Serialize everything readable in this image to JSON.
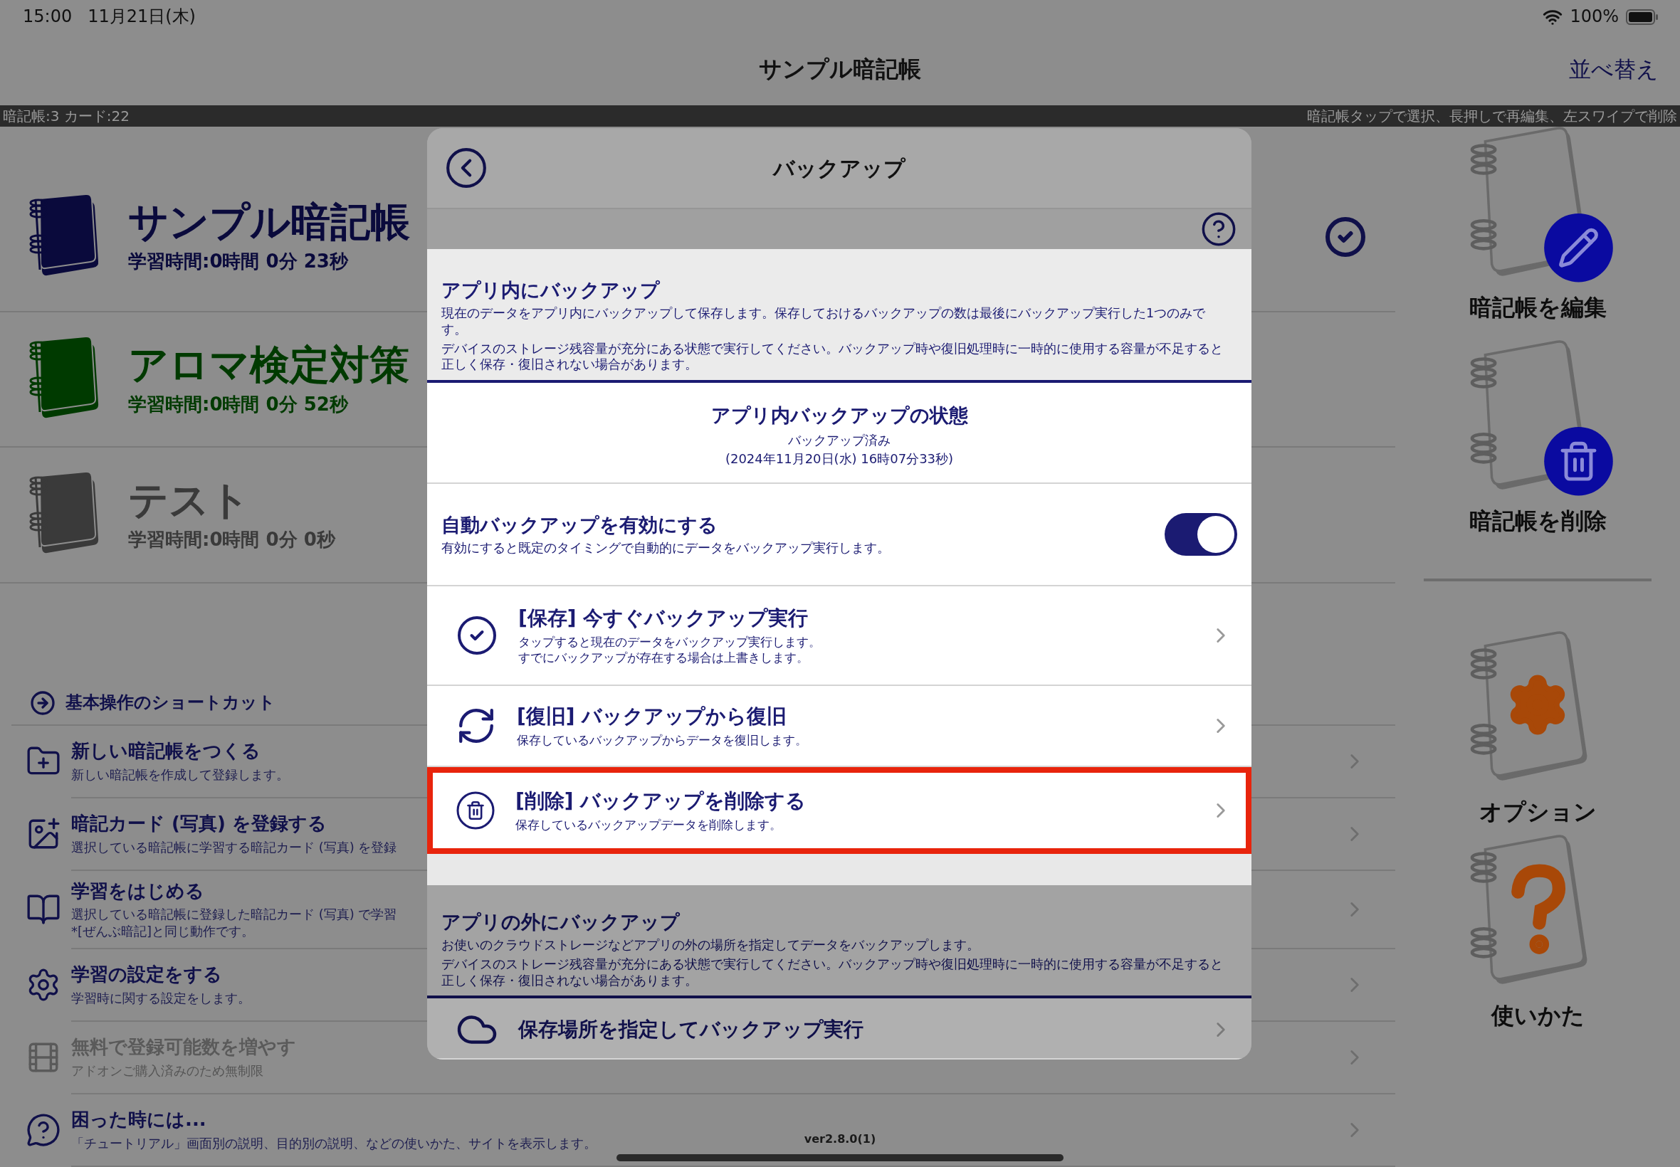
{
  "status_bar": {
    "time": "15:00",
    "date": "11月21日(木)",
    "battery": "100%"
  },
  "nav": {
    "title": "サンプル暗記帳",
    "right_button": "並べ替え"
  },
  "info_strip": {
    "counts": "暗記帳:3 カード:22",
    "hint": "暗記帳タップで選択、長押しで再編集、左スワイプで削除"
  },
  "notebooks": [
    {
      "name": "サンプル暗記帳",
      "time": "学習時間:0時間 0分 23秒",
      "color": "#0a0a3c",
      "selected": true
    },
    {
      "name": "アロマ検定対策",
      "time": "学習時間:0時間 0分 52秒",
      "color": "#003a00",
      "selected": false
    },
    {
      "name": "テスト",
      "time": "学習時間:0時間 0分 0秒",
      "color": "#3a3a3a",
      "selected": false
    }
  ],
  "shortcuts": {
    "title": "基本操作のショートカット",
    "items": [
      {
        "kind": "folder",
        "title": "新しい暗記帳をつくる",
        "description": "新しい暗記帳を作成して登録します。",
        "disabled": false
      },
      {
        "kind": "image",
        "title": "暗記カード (写真) を登録する",
        "description": "選択している暗記帳に学習する暗記カード (写真) を登録",
        "disabled": false
      },
      {
        "kind": "book",
        "title": "学習をはじめる",
        "description": "選択している暗記帳に登録した暗記カード (写真) で学習",
        "note": "*[ぜんぶ暗記]と同じ動作です。",
        "disabled": false
      },
      {
        "kind": "gear",
        "title": "学習の設定をする",
        "description": "学習時に関する設定をします。",
        "disabled": false
      },
      {
        "kind": "film",
        "title": "無料で登録可能数を増やす",
        "description": "アドオンご購入済みのため無制限",
        "disabled": true
      },
      {
        "kind": "help",
        "title": "困った時には...",
        "description": "「チュートリアル」画面別の説明、目的別の説明、などの使いかた、サイトを表示します。",
        "disabled": false
      }
    ]
  },
  "side_actions": [
    {
      "kind": "edit",
      "label": "暗記帳を編集"
    },
    {
      "kind": "delete",
      "label": "暗記帳を削除"
    },
    {
      "kind": "options",
      "label": "オプション"
    },
    {
      "kind": "help",
      "label": "使いかた"
    }
  ],
  "version": "ver2.8.0(1)",
  "modal": {
    "title": "バックアップ",
    "in_app": {
      "title": "アプリ内にバックアップ",
      "paragraphs": [
        "現在のデータをアプリ内にバックアップして保存します。保存しておけるバックアップの数は最後にバックアップ実行した1つのみです。",
        "デバイスのストレージ残容量が充分にある状態で実行してください。バックアップ時や復旧処理時に一時的に使用する容量が不足すると正しく保存・復旧されない場合があります。"
      ]
    },
    "status": {
      "title": "アプリ内バックアップの状態",
      "state": "バックアップ済み",
      "timestamp": "(2024年11月20日(水) 16時07分33秒)"
    },
    "auto_backup": {
      "title": "自動バックアップを有効にする",
      "description": "有効にすると既定のタイミングで自動的にデータをバックアップ実行します。",
      "on": true
    },
    "actions": [
      {
        "kind": "save",
        "title": "[保存] 今すぐバックアップ実行",
        "description": "タップすると現在のデータをバックアップ実行します。",
        "note": "すでにバックアップが存在する場合は上書きします。",
        "highlighted": false
      },
      {
        "kind": "restore",
        "title": "[復旧] バックアップから復旧",
        "description": "保存しているバックアップからデータを復旧します。",
        "highlighted": false
      },
      {
        "kind": "delete",
        "title": "[削除] バックアップを削除する",
        "description": "保存しているバックアップデータを削除します。",
        "highlighted": true
      }
    ],
    "external": {
      "title": "アプリの外にバックアップ",
      "paragraphs": [
        "お使いのクラウドストレージなどアプリの外の場所を指定してデータをバックアップします。",
        "デバイスのストレージ残容量が充分にある状態で実行してください。バックアップ時や復旧処理時に一時的に使用する容量が不足すると正しく保存・復旧されない場合があります。"
      ]
    },
    "external_actions": [
      {
        "kind": "cloud",
        "title": "保存場所を指定してバックアップ実行"
      }
    ]
  }
}
